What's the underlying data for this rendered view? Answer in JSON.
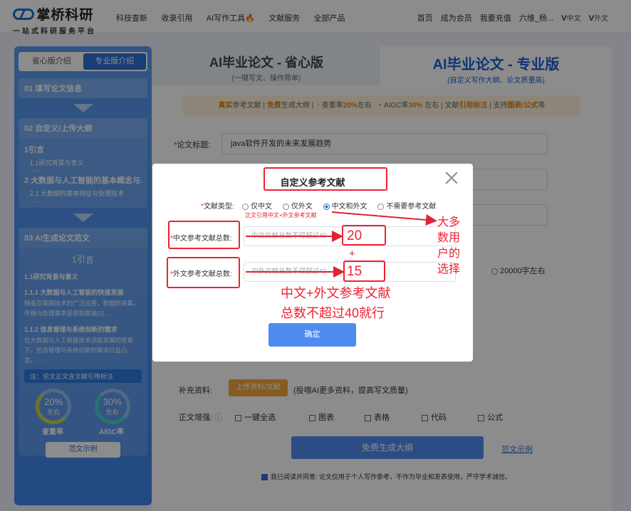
{
  "brand": {
    "name": "掌桥科研",
    "tagline": "一站式科研服务平台"
  },
  "nav": {
    "links": [
      "科技查新",
      "收录引用",
      "AI写作工具",
      "文献服务",
      "全部产品"
    ],
    "right": [
      "首页",
      "成为会员",
      "我要充值",
      "六维_杨...",
      "中文",
      "外文"
    ]
  },
  "sidebar": {
    "tabs": [
      "省心版介绍",
      "专业版介绍"
    ],
    "step1": "01 填写论文信息",
    "step2": "02 自定义/上传大纲",
    "outline": {
      "h1": "1引言",
      "h2": "1.1研究背景与意义",
      "big": "2 大数据与人工智能的基本概念与...",
      "h3": "2.1 大数据的基本特征与处理技术"
    },
    "step3": "03 AI生成论文范文",
    "paper": {
      "chapter": "1引言",
      "s1": "1.1研究背景与意义",
      "s2": "1.1.1 大数据与人工智能的快速发展",
      "p1": "随着互联网技术的广泛应用，数据的采集、传输与处理需求呈现指数级[1]...",
      "s3": "1.1.2 信息管理与系统创新的需求",
      "p2": "在大数据与人工智能技术迅猛发展的背景下，信息管理与系统创新的需求日益凸显。...."
    },
    "note": "注：论文正文含文献引用标注",
    "gauge1": {
      "pct": "20%",
      "lbl": "左右",
      "name": "查重率"
    },
    "gauge2": {
      "pct": "30%",
      "lbl": "左右",
      "name": "AIGC率"
    },
    "sample": "范文示例"
  },
  "main": {
    "left_title": "AI毕业论文 - 省心版",
    "left_sub": "(一键写文、操作简单)",
    "right_title": "AI毕业论文 - 专业版",
    "right_sub": "(自定义写作大纲、论文质量高)",
    "banner": {
      "a": "真实",
      "b": "参考文献 | ",
      "c": "免费",
      "d": "生成大纲 | ",
      "e": "查重率",
      "f": "20%",
      "g": "左右",
      "h": "AIGC率",
      "i": "30%",
      "j": " 左右 | 文献",
      "k": "引用标注",
      "l": " | 支持",
      "m": "图表/公式",
      "n": "等"
    },
    "title_label": "论文标题:",
    "title_value": "java软件开发的未来发展趋势",
    "words_option": "20000字左右",
    "supplement_label": "补充资料:",
    "upload_label": "上传资料/文献",
    "upload_hint": "(投喂AI更多资料，提高写文质量)",
    "enhance_label": "正文增强:",
    "enhance_options": [
      "一键全选",
      "图表",
      "表格",
      "代码",
      "公式"
    ],
    "generate": "免费生成大纲",
    "sample": "范文示例",
    "agree": "我已阅读并同意: 论文仅用于个人写作参考，不作为毕业和发表使用，严守学术诚信。"
  },
  "modal": {
    "title": "自定义参考文献",
    "type_label": "文献类型:",
    "type_options": [
      "仅中文",
      "仅外文",
      "中文和外文",
      "不需要参考文献"
    ],
    "selected": "中文和外文",
    "hint": "正文引用中文+外文参考文献",
    "cn_label": "中文参考文献总数:",
    "cn_placeholder": "中文文献总数不得超过40",
    "en_label": "外文参考文献总数:",
    "en_placeholder": "中外文献总数不得超过40",
    "confirm": "确定"
  },
  "annotations": {
    "cn_value": "20",
    "plus": "+",
    "en_value": "15",
    "side_note": [
      "大多",
      "数用",
      "户的",
      "选择"
    ],
    "main_note_1": "中文+外文参考文献",
    "main_note_2": "总数不超过40就行"
  },
  "colors": {
    "accent": "#2f6fd6",
    "annotation": "#e22233",
    "orange": "#f5a73c"
  }
}
